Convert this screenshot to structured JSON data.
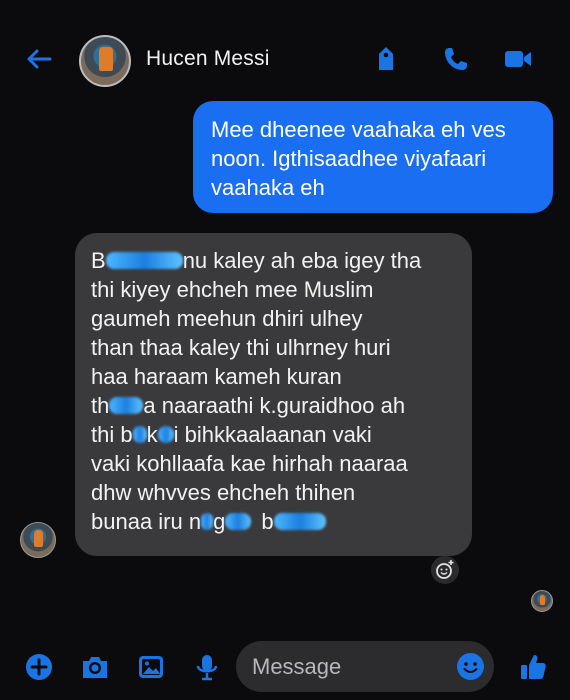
{
  "header": {
    "contact_name": "Hucen Messi",
    "icons": [
      "back-arrow-icon",
      "tag-icon",
      "phone-icon",
      "video-camera-icon"
    ]
  },
  "messages": {
    "outgoing": {
      "lines": [
        "Mee dheenee vaahaka eh ves",
        "noon. Igthisaadhee viyafaari",
        "vaahaka eh"
      ]
    },
    "incoming": {
      "lines": [
        {
          "parts": [
            "B",
            "nu kaley ah eba igey tha"
          ]
        },
        {
          "parts": [
            "thi kiyey ehcheh mee Muslim"
          ]
        },
        {
          "parts": [
            "gaumeh meehun dhiri ulhey"
          ]
        },
        {
          "parts": [
            "than thaa kaley thi ulhrney huri"
          ]
        },
        {
          "parts": [
            "haa haraam kameh kuran"
          ]
        },
        {
          "parts": [
            "th",
            "a naaraathi k.guraidhoo ah"
          ]
        },
        {
          "parts": [
            "thi b",
            "k",
            "i bihkkaalaanan vaki"
          ]
        },
        {
          "parts": [
            "vaki kohllaafa kae hirhah naaraa"
          ]
        },
        {
          "parts": [
            "dhw whvves ehcheh thihen"
          ]
        },
        {
          "parts": [
            "bunaa iru n",
            "g",
            "b",
            ""
          ]
        }
      ]
    }
  },
  "composer": {
    "placeholder": "Message",
    "icons": [
      "plus-icon",
      "camera-icon",
      "gallery-icon",
      "microphone-icon",
      "emoji-icon",
      "thumbs-up-icon"
    ]
  },
  "colors": {
    "accent": "#1a6ef2",
    "icon_blue": "#1b74e4",
    "background": "#0b0b0d",
    "incoming_bubble": "#3a3a3c",
    "redaction": "#2a8fe8"
  }
}
